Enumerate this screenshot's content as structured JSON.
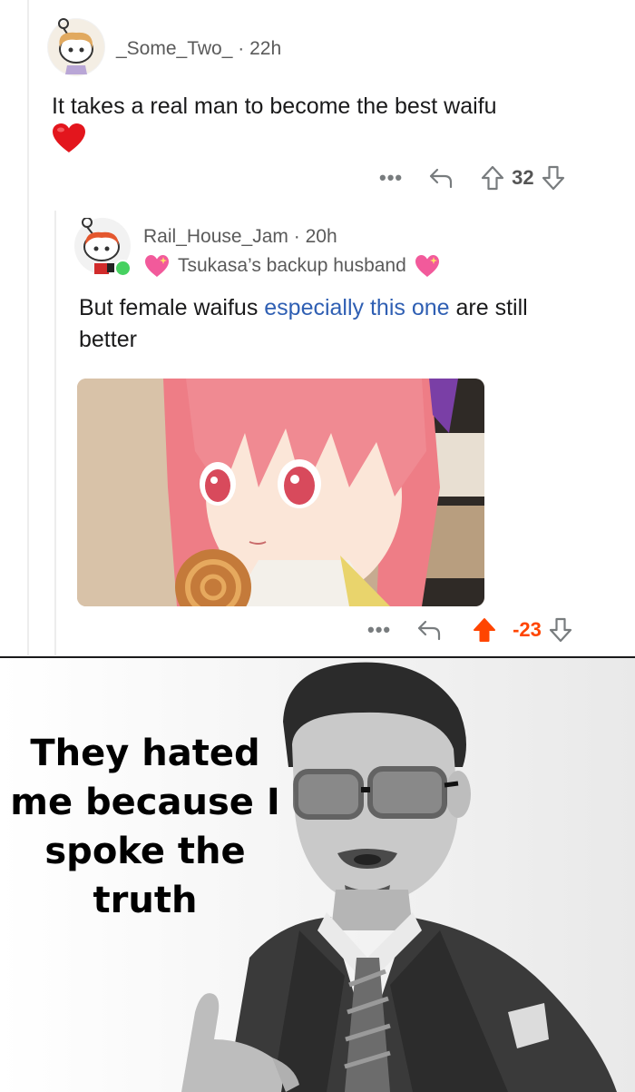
{
  "comment1": {
    "username": "_Some_Two_",
    "age": "· 22h",
    "text": "It takes a real man to become the best waifu",
    "emoji": "heart-emoji",
    "actions": {
      "more": "•••",
      "score": "32"
    }
  },
  "comment2": {
    "username": "Rail_House_Jam",
    "age": "· 20h",
    "flair": "Tsukasa’s backup husband",
    "text_before": "But female waifus ",
    "link_text": "especially this one",
    "text_after": " are still better",
    "image": "anime-girl-pink-hair",
    "actions": {
      "more": "•••",
      "score": "-23"
    },
    "vote_state": "upvoted",
    "online_status": "online"
  },
  "meme": {
    "caption": "They hated me because I spoke the truth",
    "image": "man-in-suit-glasses-grayscale"
  },
  "colors": {
    "upvote_active": "#ff4500",
    "link": "#2f5fb3",
    "online": "#46d160"
  }
}
